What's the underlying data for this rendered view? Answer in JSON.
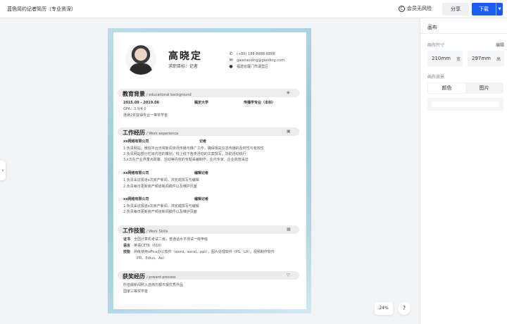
{
  "header": {
    "title": "蓝色简约记者简历（专业资深）",
    "copyright_label": "会员无风险",
    "share_label": "分享",
    "download_label": "下载"
  },
  "resume": {
    "name": "高晓定",
    "job": "求职目标：记者",
    "phone": "(+86) 188-8888-8888",
    "email": "gaoxiaoding@gaoding.com",
    "address": "福建省厦门市湖里区",
    "edu": {
      "title": "教育背景",
      "sub": "/ educational background",
      "date": "2015.09 - 2019.06",
      "school": "稿定大学",
      "major": "传播学专业（本科）",
      "gpa": "GPA：3.9/4.0",
      "award": "连续2年获得专业一等奖学金"
    },
    "work": {
      "title": "工作经历",
      "sub": "/ Work experience",
      "jobs": [
        {
          "company": "xx网络有限公司",
          "role": "记者",
          "lines": [
            "1.负责网站、微信平台日常新闻资讯传播与推广工作，确保相关信息传播的及时性与有效性",
            "2.负责网站部分栏目内容的策划，线上线下各类活动的文案撰写，协助活动执行",
            "3.x次在产业界重大政策、活动等内容的专题采编制作，业内专家、企业高管采访"
          ]
        },
        {
          "company": "xx网络有限公司",
          "role": "编辑记者",
          "lines": [
            "1.负责采访报道x次房产新闻，并完成撰写与编辑",
            "2.负责每日更新房产频道新闻稿件以及维护页面"
          ]
        },
        {
          "company": "xx网络有限公司",
          "role": "编辑记者",
          "lines": [
            "1.负责采访报道x次房产新闻，并完成撰写与编辑",
            "2.负责每日更新房产频道新闻稿件以及维护页面"
          ]
        }
      ]
    },
    "skills": {
      "title": "工作技能",
      "sub": "/ Work Skills",
      "labels": [
        "证书",
        "语言",
        "技能"
      ],
      "lines": [
        "全国计算机考试二级，普通话水平测试一级甲级",
        "英语CET6（610）",
        "熟练使用office办公软件（word、excel、ppt），图片处理软件（PS、LR），视频制作软件",
        "（PR、Edius、Ae）"
      ]
    },
    "awards": {
      "title": "获奖经历",
      "sub": "/ prward process",
      "lines": [
        "所拍摄新闻照入选南方都市报优秀作品",
        "国家三等奖学金"
      ]
    }
  },
  "panel": {
    "title": "画布",
    "size_label": "画布尺寸",
    "edit_label": "编辑",
    "width_value": "210mm",
    "width_unit": "宽",
    "height_value": "297mm",
    "height_unit": "高",
    "bg_label": "画布背景",
    "tabs": [
      "颜色",
      "图片"
    ]
  },
  "zoom_label": "24%",
  "help_label": "?",
  "collapse_label": "‹"
}
